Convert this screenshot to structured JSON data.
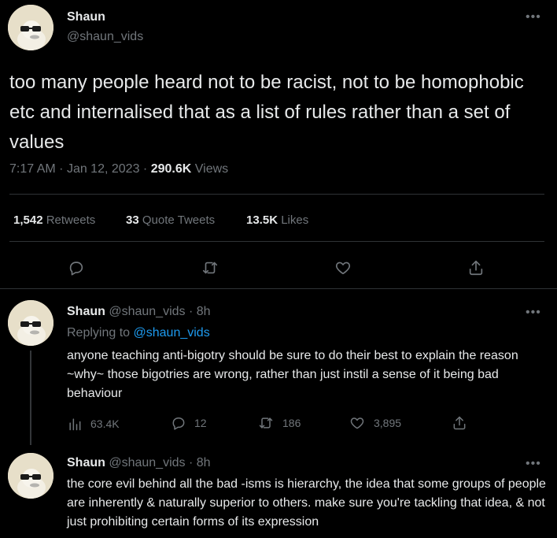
{
  "main_tweet": {
    "display_name": "Shaun",
    "handle": "@shaun_vids",
    "text": "too many people heard not to be racist, not to be homophobic etc and internalised that as a list of rules rather than a set of values",
    "time": "7:17 AM",
    "sep1": "·",
    "date": "Jan 12, 2023",
    "sep2": "·",
    "views_count": "290.6K",
    "views_label": "Views",
    "stats": {
      "retweets_count": "1,542",
      "retweets_label": "Retweets",
      "quotes_count": "33",
      "quotes_label": "Quote Tweets",
      "likes_count": "13.5K",
      "likes_label": "Likes"
    }
  },
  "reply1": {
    "display_name": "Shaun",
    "handle": "@shaun_vids",
    "sep": "·",
    "age": "8h",
    "replying_prefix": "Replying to",
    "replying_handle": "@shaun_vids",
    "text": "anyone teaching anti-bigotry should be sure to do their best to explain the reason ~why~ those bigotries are wrong, rather than just instil a sense of it being bad behaviour",
    "views": "63.4K",
    "replies": "12",
    "retweets": "186",
    "likes": "3,895"
  },
  "reply2": {
    "display_name": "Shaun",
    "handle": "@shaun_vids",
    "sep": "·",
    "age": "8h",
    "text": "the core evil behind all the bad -isms is hierarchy, the idea that some groups of people are inherently & naturally superior to others. make sure you're tackling that idea, & not just prohibiting certain forms of its expression"
  },
  "more_glyph": "•••",
  "colors": {
    "accent": "#1d9bf0",
    "muted": "#71767b",
    "text": "#e7e9ea",
    "divider": "#2f3336"
  }
}
